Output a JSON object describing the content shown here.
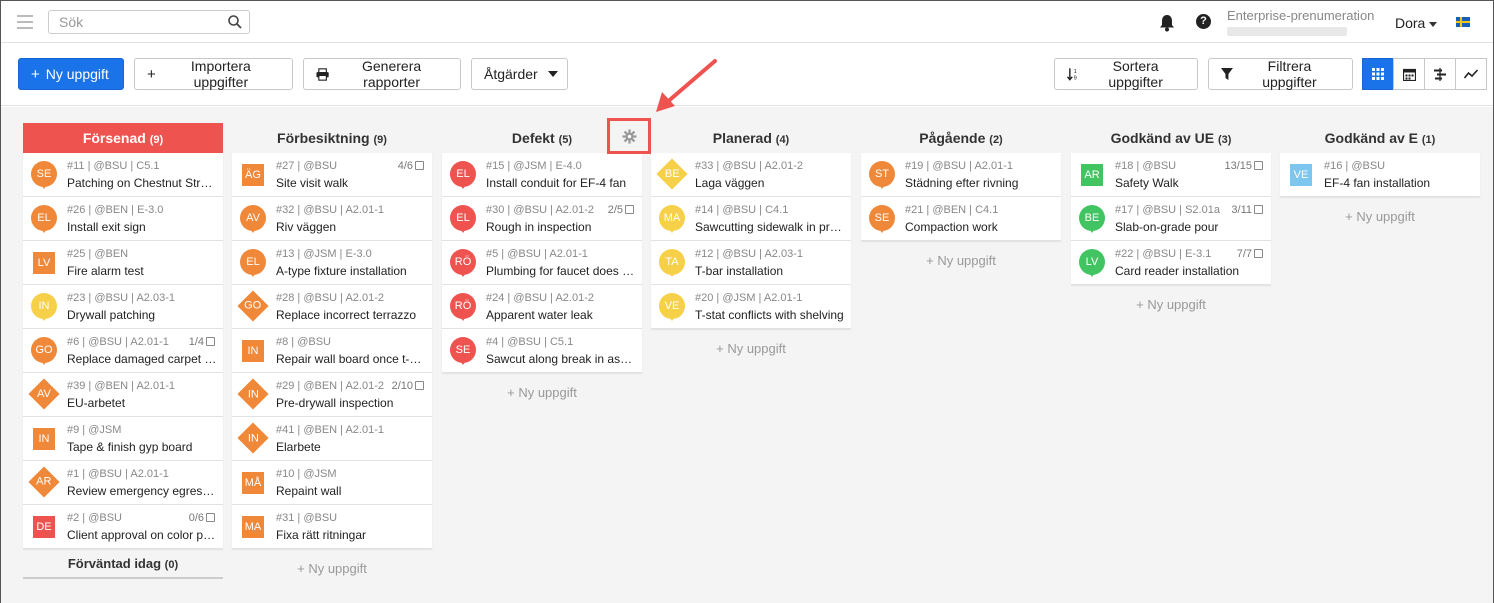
{
  "topbar": {
    "search_placeholder": "Sök",
    "subscription": "Enterprise-prenumeration",
    "user": "Dora"
  },
  "toolbar": {
    "new_task": "Ny uppgift",
    "import_tasks": "Importera uppgifter",
    "generate_reports": "Generera rapporter",
    "actions": "Åtgärder",
    "sort_tasks": "Sortera uppgifter",
    "filter_tasks": "Filtrera uppgifter"
  },
  "colors": {
    "orange": "#f0883a",
    "red": "#ef5350",
    "yellow": "#f7d04a",
    "green": "#43c463",
    "lightblue": "#7cc6ef",
    "primary": "#1a73e8"
  },
  "add_label": "+ Ny uppgift",
  "columns": [
    {
      "name": "Försenad",
      "count": "(9)",
      "cards": [
        {
          "meta": "#11 | @BSU | C5.1",
          "title": "Patching on Chestnut Street",
          "initials": "SE",
          "shape": "pin",
          "color": "orange",
          "progress": ""
        },
        {
          "meta": "#26 | @BEN | E-3.0",
          "title": "Install exit sign",
          "initials": "EL",
          "shape": "pin",
          "color": "orange",
          "progress": ""
        },
        {
          "meta": "#25 | @BEN",
          "title": "Fire alarm test",
          "initials": "LV",
          "shape": "sq",
          "color": "orange",
          "progress": ""
        },
        {
          "meta": "#23 | @BSU | A2.03-1",
          "title": "Drywall patching",
          "initials": "IN",
          "shape": "pin",
          "color": "yellow",
          "progress": ""
        },
        {
          "meta": "#6 | @BSU | A2.01-1",
          "title": "Replace damaged carpet tile",
          "initials": "GO",
          "shape": "pin",
          "color": "orange",
          "progress": "1/4"
        },
        {
          "meta": "#39 | @BEN | A2.01-1",
          "title": "EU-arbetet",
          "initials": "AV",
          "shape": "dia",
          "color": "orange",
          "progress": ""
        },
        {
          "meta": "#9 | @JSM",
          "title": "Tape & finish gyp board",
          "initials": "IN",
          "shape": "sq",
          "color": "orange",
          "progress": ""
        },
        {
          "meta": "#1 | @BSU | A2.01-1",
          "title": "Review emergency egress plan",
          "initials": "AR",
          "shape": "dia",
          "color": "orange",
          "progress": ""
        },
        {
          "meta": "#2 | @BSU",
          "title": "Client approval on color palette",
          "initials": "DE",
          "shape": "sq",
          "color": "red",
          "progress": "0/6"
        }
      ],
      "sub_heading": {
        "name": "Förväntad idag",
        "count": "(0)"
      }
    },
    {
      "name": "Förbesiktning",
      "count": "(9)",
      "cards": [
        {
          "meta": "#27 | @BSU",
          "title": "Site visit walk",
          "initials": "ÄG",
          "shape": "sq",
          "color": "orange",
          "progress": "4/6"
        },
        {
          "meta": "#32 | @BSU | A2.01-1",
          "title": "Riv väggen",
          "initials": "AV",
          "shape": "pin",
          "color": "orange",
          "progress": ""
        },
        {
          "meta": "#13 | @JSM | E-3.0",
          "title": "A-type fixture installation",
          "initials": "EL",
          "shape": "pin",
          "color": "orange",
          "progress": ""
        },
        {
          "meta": "#28 | @BSU | A2.01-2",
          "title": "Replace incorrect terrazzo",
          "initials": "GO",
          "shape": "dia",
          "color": "orange",
          "progress": ""
        },
        {
          "meta": "#8 | @BSU",
          "title": "Repair wall board once t-stat is moved",
          "initials": "IN",
          "shape": "sq",
          "color": "orange",
          "progress": ""
        },
        {
          "meta": "#29 | @BEN | A2.01-2",
          "title": "Pre-drywall inspection",
          "initials": "IN",
          "shape": "dia",
          "color": "orange",
          "progress": "2/10"
        },
        {
          "meta": "#41 | @BEN | A2.01-1",
          "title": "Elarbete",
          "initials": "IN",
          "shape": "dia",
          "color": "orange",
          "progress": ""
        },
        {
          "meta": "#10 | @JSM",
          "title": "Repaint wall",
          "initials": "MÅ",
          "shape": "sq",
          "color": "orange",
          "progress": ""
        },
        {
          "meta": "#31 | @BSU",
          "title": "Fixa rätt ritningar",
          "initials": "MA",
          "shape": "sq",
          "color": "orange",
          "progress": ""
        }
      ]
    },
    {
      "name": "Defekt",
      "count": "(5)",
      "cards": [
        {
          "meta": "#15 | @JSM | E-4.0",
          "title": "Install conduit for EF-4 fan",
          "initials": "EL",
          "shape": "pin",
          "color": "red",
          "progress": ""
        },
        {
          "meta": "#30 | @BSU | A2.01-2",
          "title": "Rough in inspection",
          "initials": "EL",
          "shape": "pin",
          "color": "red",
          "progress": "2/5"
        },
        {
          "meta": "#5 | @BSU | A2.01-1",
          "title": "Plumbing for faucet does not work",
          "initials": "RÖ",
          "shape": "pin",
          "color": "red",
          "progress": ""
        },
        {
          "meta": "#24 | @BSU | A2.01-2",
          "title": "Apparent water leak",
          "initials": "RÖ",
          "shape": "pin",
          "color": "red",
          "progress": ""
        },
        {
          "meta": "#4 | @BSU | C5.1",
          "title": "Sawcut along break in asphalt",
          "initials": "SE",
          "shape": "pin",
          "color": "red",
          "progress": ""
        }
      ]
    },
    {
      "name": "Planerad",
      "count": "(4)",
      "cards": [
        {
          "meta": "#33 | @BSU | A2.01-2",
          "title": "Laga väggen",
          "initials": "BE",
          "shape": "dia",
          "color": "yellow",
          "progress": ""
        },
        {
          "meta": "#14 | @BSU | C4.1",
          "title": "Sawcutting sidewalk in preparation",
          "initials": "MA",
          "shape": "pin",
          "color": "yellow",
          "progress": ""
        },
        {
          "meta": "#12 | @BSU | A2.03-1",
          "title": "T-bar installation",
          "initials": "TA",
          "shape": "pin",
          "color": "yellow",
          "progress": ""
        },
        {
          "meta": "#20 | @JSM | A2.01-1",
          "title": "T-stat conflicts with shelving",
          "initials": "VE",
          "shape": "pin",
          "color": "yellow",
          "progress": ""
        }
      ]
    },
    {
      "name": "Pågående",
      "count": "(2)",
      "cards": [
        {
          "meta": "#19 | @BSU | A2.01-1",
          "title": "Städning efter rivning",
          "initials": "ST",
          "shape": "pin",
          "color": "orange",
          "progress": ""
        },
        {
          "meta": "#21 | @BEN | C4.1",
          "title": "Compaction work",
          "initials": "SE",
          "shape": "pin",
          "color": "orange",
          "progress": ""
        }
      ]
    },
    {
      "name": "Godkänd av UE",
      "count": "(3)",
      "cards": [
        {
          "meta": "#18 | @BSU",
          "title": "Safety Walk",
          "initials": "AR",
          "shape": "sq",
          "color": "green",
          "progress": "13/15"
        },
        {
          "meta": "#17 | @BSU | S2.01a",
          "title": "Slab-on-grade pour",
          "initials": "BE",
          "shape": "pin",
          "color": "green",
          "progress": "3/11"
        },
        {
          "meta": "#22 | @BSU | E-3.1",
          "title": "Card reader installation",
          "initials": "LV",
          "shape": "pin",
          "color": "green",
          "progress": "7/7"
        }
      ]
    },
    {
      "name": "Godkänd av E",
      "count": "(1)",
      "cards": [
        {
          "meta": "#16 | @BSU",
          "title": "EF-4 fan installation",
          "initials": "VE",
          "shape": "sq",
          "color": "lightblue",
          "progress": ""
        }
      ]
    }
  ]
}
